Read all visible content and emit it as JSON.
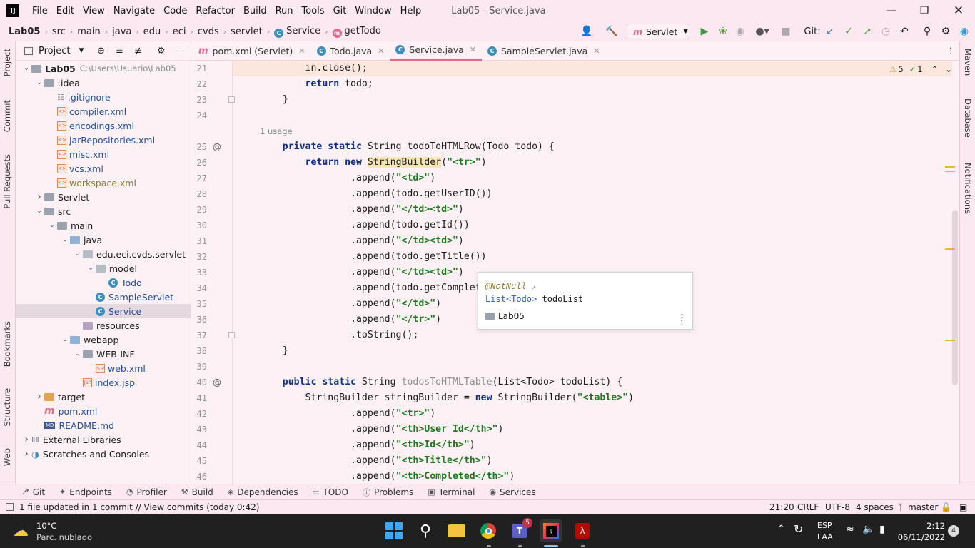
{
  "title_bar": {
    "menu": [
      "File",
      "Edit",
      "View",
      "Navigate",
      "Code",
      "Refactor",
      "Build",
      "Run",
      "Tools",
      "Git",
      "Window",
      "Help"
    ],
    "window_title": "Lab05 - Service.java"
  },
  "nav_bar": {
    "breadcrumbs": [
      "Lab05",
      "src",
      "main",
      "java",
      "edu",
      "eci",
      "cvds",
      "servlet",
      "Service",
      "getTodo"
    ],
    "run_config": "Servlet",
    "git_label": "Git:"
  },
  "left_strip": {
    "items": [
      "Project",
      "Commit",
      "Pull Requests",
      "Bookmarks",
      "Structure",
      "Web"
    ]
  },
  "right_strip": {
    "items": [
      "Maven",
      "Database",
      "Notifications"
    ]
  },
  "project_panel": {
    "title": "Project",
    "tree": [
      {
        "label": "Lab05",
        "extra": "C:\\Users\\Usuario\\Lab05",
        "depth": 0,
        "kind": "folder",
        "arrow": "v"
      },
      {
        "label": ".idea",
        "depth": 1,
        "kind": "folder",
        "arrow": "v"
      },
      {
        "label": ".gitignore",
        "depth": 2,
        "kind": "file"
      },
      {
        "label": "compiler.xml",
        "depth": 2,
        "kind": "xml"
      },
      {
        "label": "encodings.xml",
        "depth": 2,
        "kind": "xml"
      },
      {
        "label": "jarRepositories.xml",
        "depth": 2,
        "kind": "xml"
      },
      {
        "label": "misc.xml",
        "depth": 2,
        "kind": "xml"
      },
      {
        "label": "vcs.xml",
        "depth": 2,
        "kind": "xml"
      },
      {
        "label": "workspace.xml",
        "depth": 2,
        "kind": "xml-mod"
      },
      {
        "label": "Servlet",
        "depth": 1,
        "kind": "folder",
        "arrow": ">"
      },
      {
        "label": "src",
        "depth": 1,
        "kind": "folder",
        "arrow": "v"
      },
      {
        "label": "main",
        "depth": 2,
        "kind": "folder",
        "arrow": "v"
      },
      {
        "label": "java",
        "depth": 3,
        "kind": "folder-blue",
        "arrow": "v"
      },
      {
        "label": "edu.eci.cvds.servlet",
        "depth": 4,
        "kind": "package",
        "arrow": "v"
      },
      {
        "label": "model",
        "depth": 5,
        "kind": "package",
        "arrow": "v"
      },
      {
        "label": "Todo",
        "depth": 6,
        "kind": "class"
      },
      {
        "label": "SampleServlet",
        "depth": 5,
        "kind": "class"
      },
      {
        "label": "Service",
        "depth": 5,
        "kind": "class",
        "selected": true
      },
      {
        "label": "resources",
        "depth": 4,
        "kind": "folder-res"
      },
      {
        "label": "webapp",
        "depth": 3,
        "kind": "folder-web",
        "arrow": "v"
      },
      {
        "label": "WEB-INF",
        "depth": 4,
        "kind": "folder",
        "arrow": "v"
      },
      {
        "label": "web.xml",
        "depth": 5,
        "kind": "xml"
      },
      {
        "label": "index.jsp",
        "depth": 4,
        "kind": "jsp"
      },
      {
        "label": "target",
        "depth": 1,
        "kind": "folder-orange",
        "arrow": ">"
      },
      {
        "label": "pom.xml",
        "depth": 1,
        "kind": "maven"
      },
      {
        "label": "README.md",
        "depth": 1,
        "kind": "md"
      },
      {
        "label": "External Libraries",
        "depth": 0,
        "kind": "lib",
        "arrow": ">"
      },
      {
        "label": "Scratches and Consoles",
        "depth": 0,
        "kind": "scratch",
        "arrow": ">"
      }
    ]
  },
  "editor_tabs": [
    {
      "label": "pom.xml (Servlet)",
      "icon": "m",
      "active": false
    },
    {
      "label": "Todo.java",
      "icon": "c",
      "active": false
    },
    {
      "label": "Service.java",
      "icon": "c",
      "active": true
    },
    {
      "label": "SampleServlet.java",
      "icon": "c",
      "active": false
    }
  ],
  "inspections": {
    "warnings": "5",
    "ok": "1"
  },
  "code_lines": [
    {
      "n": "21",
      "html": "        in.close();"
    },
    {
      "n": "22",
      "html": "        <span class='kw'>return</span> todo;"
    },
    {
      "n": "23",
      "html": "    }"
    },
    {
      "n": "24",
      "html": ""
    },
    {
      "n": "",
      "html": "usage"
    },
    {
      "n": "25",
      "html": "    <span class='kw'>private static</span> String todoToHTMLRow(Todo todo) {"
    },
    {
      "n": "26",
      "html": "        <span class='kw'>return new</span> <span class='hlb'>StringBuilder</span>(<span class='str'>\"&lt;tr&gt;\"</span>)"
    },
    {
      "n": "27",
      "html": "                .append(<span class='str'>\"&lt;td&gt;\"</span>)"
    },
    {
      "n": "28",
      "html": "                .append(todo.getUserID())"
    },
    {
      "n": "29",
      "html": "                .append(<span class='str'>\"&lt;/td&gt;&lt;td&gt;\"</span>)"
    },
    {
      "n": "30",
      "html": "                .append(todo.getId())"
    },
    {
      "n": "31",
      "html": "                .append(<span class='str'>\"&lt;/td&gt;&lt;td&gt;\"</span>)"
    },
    {
      "n": "32",
      "html": "                .append(todo.getTitle())"
    },
    {
      "n": "33",
      "html": "                .append(<span class='str'>\"&lt;/td&gt;&lt;td&gt;\"</span>)"
    },
    {
      "n": "34",
      "html": "                .append(todo.getCompleted("
    },
    {
      "n": "35",
      "html": "                .append(<span class='str'>\"&lt;/td&gt;\"</span>)"
    },
    {
      "n": "36",
      "html": "                .append(<span class='str'>\"&lt;/tr&gt;\"</span>)"
    },
    {
      "n": "37",
      "html": "                .toString();"
    },
    {
      "n": "38",
      "html": "    }"
    },
    {
      "n": "39",
      "html": ""
    },
    {
      "n": "40",
      "html": "    <span class='kw'>public static</span> String <span class='gray'>todosToHTMLTable</span>(List&lt;Todo&gt; todoList) {"
    },
    {
      "n": "41",
      "html": "        StringBuilder stringBuilder = <span class='kw'>new</span> StringBuilder(<span class='str'>\"&lt;table&gt;\"</span>)"
    },
    {
      "n": "42",
      "html": "                .append(<span class='str'>\"&lt;tr&gt;\"</span>)"
    },
    {
      "n": "43",
      "html": "                .append(<span class='str'>\"&lt;th&gt;User Id&lt;/th&gt;\"</span>)"
    },
    {
      "n": "44",
      "html": "                .append(<span class='str'>\"&lt;th&gt;Id&lt;/th&gt;\"</span>)"
    },
    {
      "n": "45",
      "html": "                .append(<span class='str'>\"&lt;th&gt;Title&lt;/th&gt;\"</span>)"
    },
    {
      "n": "46",
      "html": "                .append(<span class='str'>\"&lt;th&gt;Completed&lt;/th&gt;\"</span>)"
    }
  ],
  "usage_hint": "1 usage",
  "popup": {
    "annotation": "@NotNull",
    "type_text": "List<Todo>",
    "param": "todoList",
    "module": "Lab05"
  },
  "tool_windows": [
    "Git",
    "Endpoints",
    "Profiler",
    "Build",
    "Dependencies",
    "TODO",
    "Problems",
    "Terminal",
    "Services"
  ],
  "status_bar": {
    "message": "1 file updated in 1 commit // View commits (today 0:42)",
    "position": "21:20",
    "line_sep": "CRLF",
    "encoding": "UTF-8",
    "indent": "4 spaces",
    "branch": "master"
  },
  "taskbar": {
    "temp": "10°C",
    "weather": "Parc. nublado",
    "teams_badge": "5",
    "lang1": "ESP",
    "lang2": "LAA",
    "time": "2:12",
    "date": "06/11/2022",
    "notif": "4"
  }
}
